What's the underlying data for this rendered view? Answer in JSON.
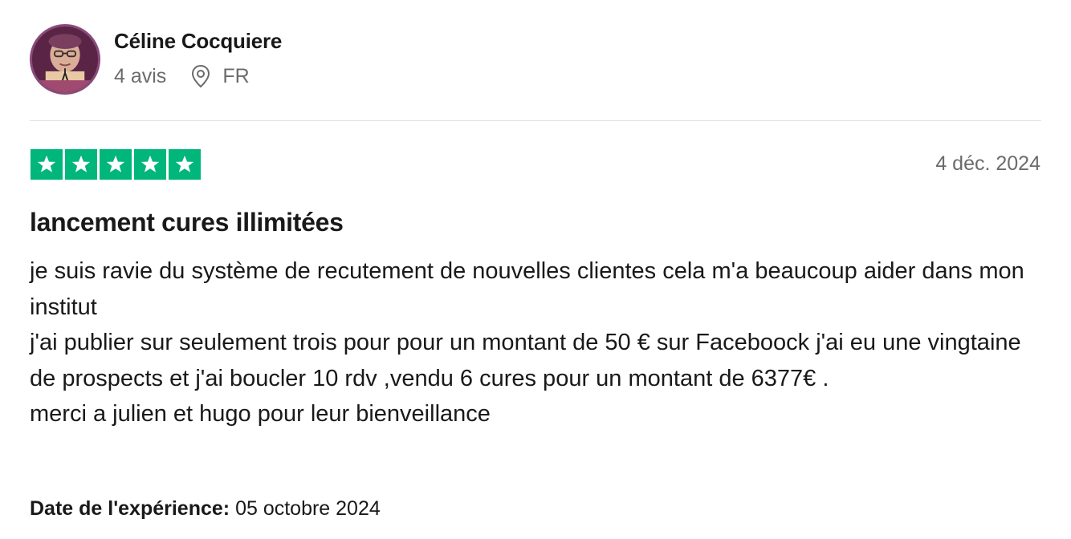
{
  "author": {
    "name": "Céline Cocquiere",
    "review_count": "4 avis",
    "country": "FR",
    "location_icon": "location-pin-icon"
  },
  "review": {
    "rating": 5,
    "rating_max": 5,
    "star_color": "#00b67a",
    "date": "4 déc. 2024",
    "title": "lancement cures illimitées",
    "body_lines": [
      "je suis ravie du système de recutement de nouvelles clientes cela m'a beaucoup aider dans mon institut",
      "j'ai publier sur seulement trois pour pour un montant de 50 € sur Faceboock j'ai eu une vingtaine de prospects et j'ai boucler 10 rdv ,vendu 6 cures pour un montant de 6377€ .",
      "merci a julien et hugo pour leur bienveillance"
    ],
    "experience_label": "Date de l'expérience:",
    "experience_date": "05 octobre 2024"
  }
}
